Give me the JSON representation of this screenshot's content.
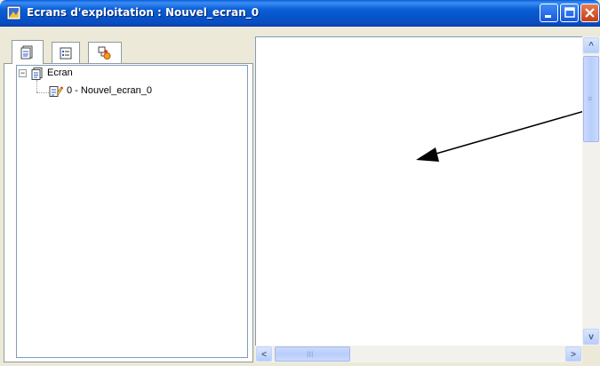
{
  "window": {
    "title": "Ecrans d'exploitation : Nouvel_ecran_0",
    "title_icon": "screen-app-icon",
    "accent_color": "#0a5fd6",
    "controls": {
      "minimize_icon": "minimize-icon",
      "maximize_icon": "maximize-icon",
      "close_icon": "close-icon"
    }
  },
  "tree_panel": {
    "tabs": [
      {
        "icon": "screens-list-icon",
        "selected": true
      },
      {
        "icon": "properties-list-icon",
        "selected": false
      },
      {
        "icon": "objects-icon",
        "selected": false
      }
    ],
    "nodes": [
      {
        "label": "Ecran",
        "expander": "−",
        "icon": "screen-folder-icon"
      },
      {
        "label": "0 - Nouvel_ecran_0",
        "icon": "screen-edit-icon"
      }
    ]
  },
  "canvas": {
    "annotation": "arrow-pointer",
    "hscroll": {
      "left_label": "<",
      "right_label": ">",
      "grip": "III"
    },
    "vscroll": {
      "up_label": "^",
      "down_label": "v",
      "grip": "≡"
    }
  }
}
